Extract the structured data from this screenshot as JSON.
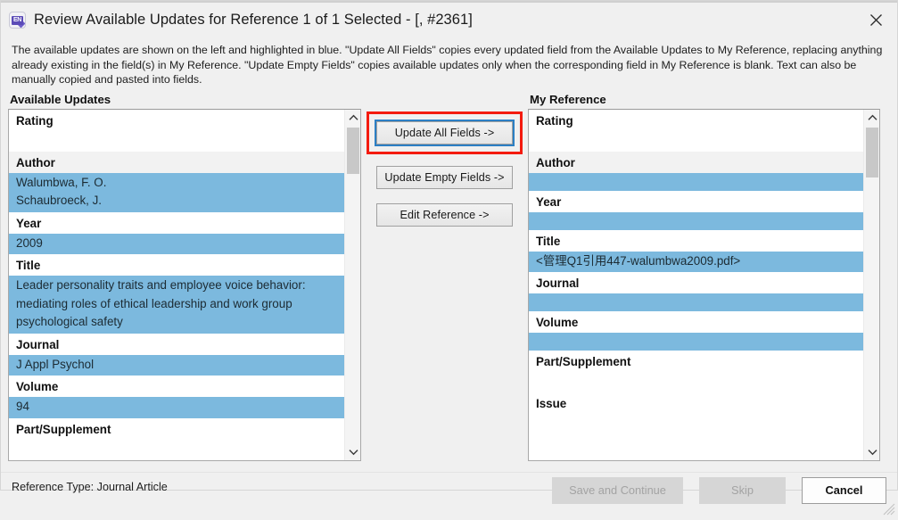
{
  "window": {
    "title": "Review Available Updates for Reference 1 of 1 Selected - [,  #2361]",
    "app_icon": "endnote-icon",
    "app_icon_text": "EN",
    "close_icon": "close-icon"
  },
  "description": "The available updates are shown on the left and highlighted in blue. \"Update All Fields\" copies every updated field from the Available Updates to My Reference, replacing anything already existing in the field(s) in My Reference. \"Update Empty Fields\" copies available updates only when the corresponding field in My Reference is blank. Text can also be manually copied and pasted into fields.",
  "available_updates": {
    "header": "Available Updates",
    "fields": [
      {
        "label": "Rating",
        "value": "",
        "highlighted": false,
        "shaded": false
      },
      {
        "label": "Author",
        "value": "Walumbwa, F. O.\nSchaubroeck, J.",
        "highlighted": true,
        "shaded": true
      },
      {
        "label": "Year",
        "value": "2009",
        "highlighted": true,
        "shaded": false
      },
      {
        "label": "Title",
        "value": "Leader personality traits and employee voice behavior: mediating roles of ethical leadership and work group psychological safety",
        "highlighted": true,
        "shaded": false
      },
      {
        "label": "Journal",
        "value": "J Appl Psychol",
        "highlighted": true,
        "shaded": false
      },
      {
        "label": "Volume",
        "value": "94",
        "highlighted": true,
        "shaded": false
      },
      {
        "label": "Part/Supplement",
        "value": "",
        "highlighted": false,
        "shaded": false
      }
    ]
  },
  "my_reference": {
    "header": "My Reference",
    "fields": [
      {
        "label": "Rating",
        "value": "",
        "highlighted": false,
        "shaded": false
      },
      {
        "label": "Author",
        "value": "",
        "highlighted": true,
        "shaded": true
      },
      {
        "label": "Year",
        "value": "",
        "highlighted": true,
        "shaded": false
      },
      {
        "label": "Title",
        "value": "<管理Q1引用447-walumbwa2009.pdf>",
        "highlighted": true,
        "shaded": false
      },
      {
        "label": "Journal",
        "value": "",
        "highlighted": true,
        "shaded": false
      },
      {
        "label": "Volume",
        "value": "",
        "highlighted": true,
        "shaded": false
      },
      {
        "label": "Part/Supplement",
        "value": "",
        "highlighted": false,
        "shaded": false
      },
      {
        "label": "Issue",
        "value": "",
        "highlighted": false,
        "shaded": false
      }
    ]
  },
  "middle_buttons": {
    "update_all_fields": "Update All Fields ->",
    "update_empty_fields": "Update Empty Fields ->",
    "edit_reference": "Edit Reference ->"
  },
  "footer": {
    "reference_type": "Reference Type: Journal Article",
    "save_and_continue": "Save and Continue",
    "skip": "Skip",
    "cancel": "Cancel"
  },
  "colors": {
    "highlight_blue": "#7cb9de",
    "annotation_red": "#f41b0f",
    "focus_blue": "#2c7fc4",
    "window_bg": "#f0f0f0",
    "panel_bg": "#ffffff"
  }
}
